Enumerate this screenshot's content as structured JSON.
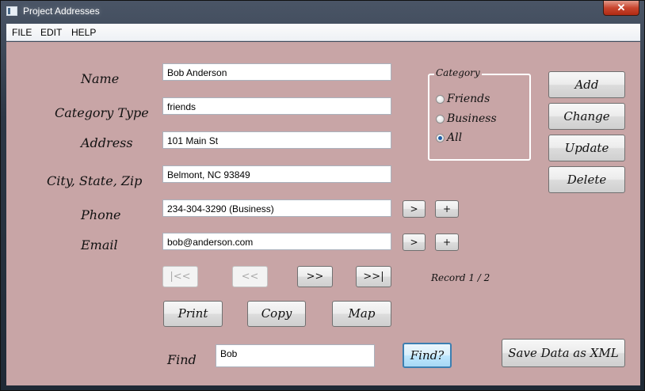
{
  "window": {
    "title": "Project Addresses",
    "close_glyph": "✕"
  },
  "menu": {
    "file": "FILE",
    "edit": "EDIT",
    "help": "HELP"
  },
  "form": {
    "name_label": "Name",
    "category_type_label": "Category Type",
    "address_label": "Address",
    "city_label": "City, State, Zip",
    "phone_label": "Phone",
    "email_label": "Email",
    "find_label": "Find",
    "name_value": "Bob Anderson",
    "category_type_value": "friends",
    "address_value": "101 Main St",
    "city_value": "Belmont, NC 93849",
    "phone_value": "234-304-3290  (Business)",
    "email_value": "bob@anderson.com",
    "find_value": "Bob"
  },
  "category": {
    "legend": "Category",
    "options": [
      "Friends",
      "Business",
      "All"
    ],
    "selected": "All"
  },
  "buttons": {
    "add": "Add",
    "change": "Change",
    "update": "Update",
    "delete": "Delete",
    "phone_next": ">",
    "phone_add": "+",
    "email_next": ">",
    "email_add": "+",
    "first": "|<<",
    "prev": "<<",
    "next": ">>",
    "last": ">>|",
    "print": "Print",
    "copy": "Copy",
    "map": "Map",
    "find": "Find?",
    "save_xml": "Save Data as XML"
  },
  "status": {
    "record": "Record 1 / 2"
  }
}
